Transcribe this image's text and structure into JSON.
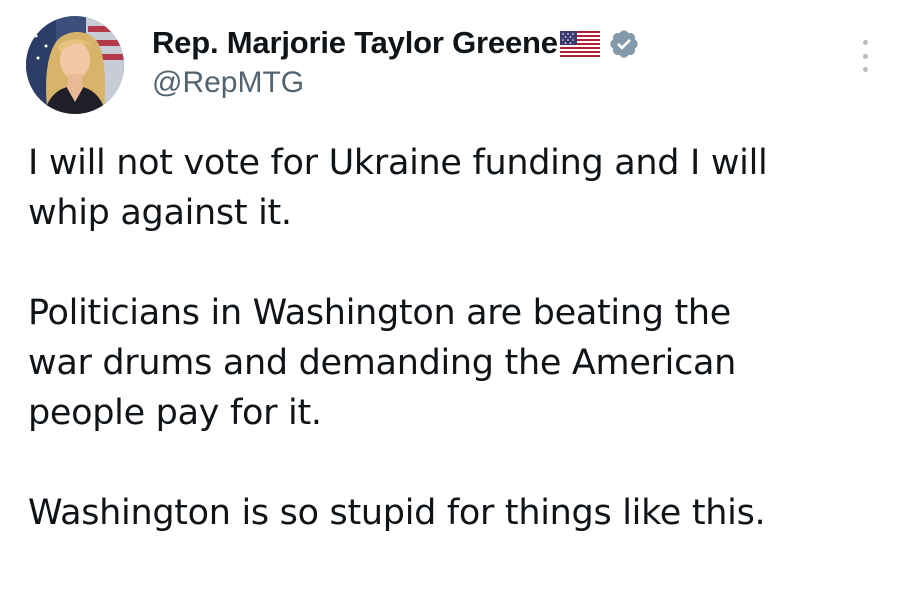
{
  "author": {
    "display_name": "Rep. Marjorie Taylor Greene",
    "handle": "@RepMTG",
    "name_emoji": "us-flag-icon",
    "verified_badge": "verified-badge-icon",
    "verified_color": "#829aab"
  },
  "more_menu": {
    "icon": "more-vertical-icon"
  },
  "tweet": {
    "paragraphs": [
      {
        "lines": [
          "I will not vote for Ukraine funding and I will",
          "whip against it."
        ]
      },
      {
        "lines": [
          "Politicians in Washington are beating the",
          "war drums and demanding the American",
          "people pay for it."
        ]
      },
      {
        "lines": [
          "Washington is so stupid for things like this."
        ]
      }
    ]
  },
  "colors": {
    "text": "#0f1419",
    "secondary_text": "#536471",
    "background": "#ffffff"
  }
}
